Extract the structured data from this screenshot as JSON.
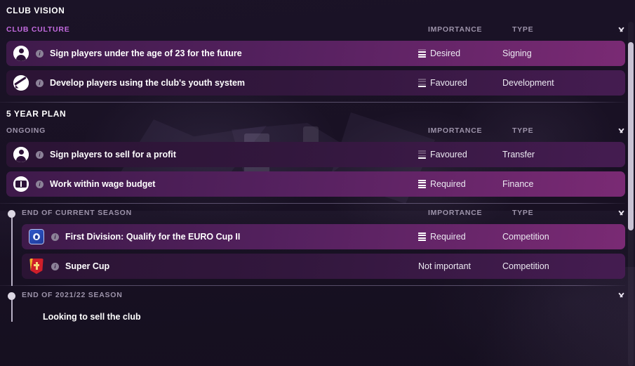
{
  "window": {
    "title": "CLUB VISION"
  },
  "colors": {
    "accent_heading": "#c46be0",
    "row_light": "#7a2a74",
    "row_dark": "#32173d",
    "page_background": "#16101f",
    "muted_text": "#9d93aa"
  },
  "columns": {
    "importance": "IMPORTANCE",
    "type": "TYPE",
    "collapse_icon": "chevron-down-icon"
  },
  "sections": [
    {
      "id": "club-culture",
      "title": "CLUB CULTURE",
      "accent": true,
      "goals": [
        {
          "icon": "person-icon",
          "info_icon": "info-icon",
          "text": "Sign players under the age of 23 for the future",
          "importance": "Desired",
          "importance_level": 3,
          "type": "Signing",
          "highlighted": true
        },
        {
          "icon": "growth-chart-icon",
          "info_icon": "info-icon",
          "text": "Develop players using the club's youth system",
          "importance": "Favoured",
          "importance_level": 1,
          "type": "Development",
          "highlighted": false
        }
      ]
    }
  ],
  "plan": {
    "title": "5 YEAR PLAN",
    "groups": [
      {
        "id": "ongoing",
        "title": "ONGOING",
        "timeline": false,
        "goals": [
          {
            "icon": "person-icon",
            "info_icon": "info-icon",
            "text": "Sign players to sell for a profit",
            "importance": "Favoured",
            "importance_level": 1,
            "type": "Transfer",
            "highlighted": false
          },
          {
            "icon": "money-icon",
            "info_icon": "info-icon",
            "text": "Work within wage budget",
            "importance": "Required",
            "importance_level": 4,
            "type": "Finance",
            "highlighted": true
          }
        ]
      },
      {
        "id": "end-of-current-season",
        "title": "END OF CURRENT SEASON",
        "timeline": true,
        "goals": [
          {
            "icon": "competition-crest-blue-icon",
            "info_icon": "info-icon",
            "text": "First Division: Qualify for the EURO Cup II",
            "importance": "Required",
            "importance_level": 4,
            "type": "Competition",
            "highlighted": true
          },
          {
            "icon": "competition-crest-red-icon",
            "info_icon": "info-icon",
            "text": "Super Cup",
            "importance": "Not important",
            "importance_level": 0,
            "type": "Competition",
            "highlighted": false
          }
        ]
      },
      {
        "id": "end-of-2021-22-season",
        "title": "END OF 2021/22 SEASON",
        "timeline": true,
        "plain_goals": [
          "Looking to sell the club"
        ],
        "goals": []
      }
    ]
  },
  "scrollbar": {
    "name": "vertical-scrollbar"
  }
}
